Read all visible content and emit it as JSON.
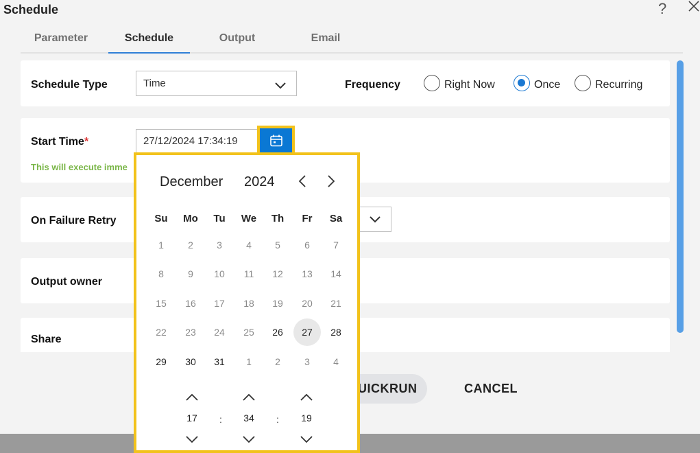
{
  "dialog": {
    "title": "Schedule",
    "help": "?"
  },
  "tabs": [
    {
      "label": "Parameter"
    },
    {
      "label": "Schedule"
    },
    {
      "label": "Output"
    },
    {
      "label": "Email"
    }
  ],
  "schedule_type": {
    "label": "Schedule Type",
    "value": "Time"
  },
  "frequency": {
    "label": "Frequency",
    "options": [
      {
        "label": "Right Now",
        "checked": false
      },
      {
        "label": "Once",
        "checked": true
      },
      {
        "label": "Recurring",
        "checked": false
      }
    ]
  },
  "start_time": {
    "label": "Start Time",
    "required_mark": "*",
    "value": "27/12/2024 17:34:19",
    "hint": "This will execute imme"
  },
  "on_failure_retry": {
    "label": "On Failure Retry"
  },
  "output_owner": {
    "label": "Output owner"
  },
  "share": {
    "label": "Share"
  },
  "buttons": {
    "quickrun": "QUICKRUN",
    "cancel": "CANCEL"
  },
  "calendar": {
    "month": "December",
    "year": "2024",
    "weekdays": [
      "Su",
      "Mo",
      "Tu",
      "We",
      "Th",
      "Fr",
      "Sa"
    ],
    "weeks": [
      [
        "1",
        "2",
        "3",
        "4",
        "5",
        "6",
        "7"
      ],
      [
        "8",
        "9",
        "10",
        "11",
        "12",
        "13",
        "14"
      ],
      [
        "15",
        "16",
        "17",
        "18",
        "19",
        "20",
        "21"
      ],
      [
        "22",
        "23",
        "24",
        "25",
        "26",
        "27",
        "28"
      ],
      [
        "29",
        "30",
        "31",
        "1",
        "2",
        "3",
        "4"
      ]
    ],
    "selected_day": "27",
    "time": {
      "hour": "17",
      "minute": "34",
      "second": "19",
      "separator": ":"
    }
  },
  "colors": {
    "accent": "#0a78d4",
    "highlight": "#f2c21b",
    "hint": "#7ab648"
  }
}
